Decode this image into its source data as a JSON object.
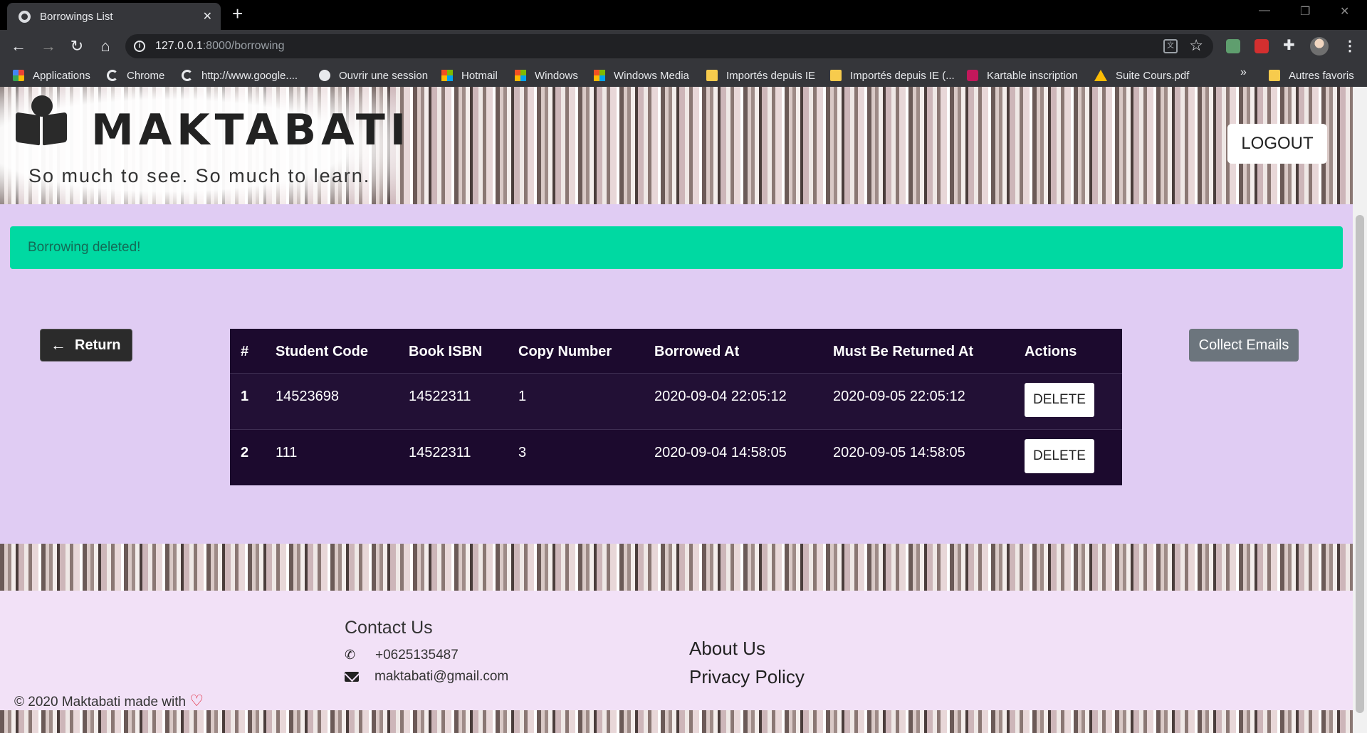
{
  "browser": {
    "tab_title": "Borrowings List",
    "url_host": "127.0.0.1",
    "url_rest": ":8000/borrowing",
    "bookmarks": [
      "Applications",
      "Chrome",
      "http://www.google....",
      "Ouvrir une session",
      "Hotmail",
      "Windows",
      "Windows Media",
      "Importés depuis IE",
      "Importés depuis IE (...",
      "Kartable inscription",
      "Suite Cours.pdf",
      "Autres favoris"
    ],
    "bookmark_icons": [
      "apps-icon",
      "google-icon",
      "google-icon",
      "globe-icon",
      "windows-icon",
      "windows-icon",
      "windows-icon",
      "folder-icon",
      "folder-icon",
      "kartable-icon",
      "drive-icon",
      "folder-icon"
    ]
  },
  "header": {
    "brand": "MAKTABATI",
    "tagline": "So much to see. So much to learn.",
    "logout_label": "LOGOUT"
  },
  "alert": {
    "message": "Borrowing deleted!",
    "color": "#00d9a2"
  },
  "actions": {
    "return_label": "Return",
    "collect_label": "Collect Emails"
  },
  "table": {
    "columns": [
      "#",
      "Student Code",
      "Book ISBN",
      "Copy Number",
      "Borrowed At",
      "Must Be Returned At",
      "Actions"
    ],
    "rows": [
      {
        "index": "1",
        "student_code": "14523698",
        "isbn": "14522311",
        "copy_number": "1",
        "borrowed_at": "2020-09-04 22:05:12",
        "due_at": "2020-09-05 22:05:12",
        "action": "DELETE"
      },
      {
        "index": "2",
        "student_code": "111",
        "isbn": "14522311",
        "copy_number": "3",
        "borrowed_at": "2020-09-04 14:58:05",
        "due_at": "2020-09-05 14:58:05",
        "action": "DELETE"
      }
    ]
  },
  "footer": {
    "contact_heading": "Contact Us",
    "phone": "+0625135487",
    "email": "maktabati@gmail.com",
    "about": "About Us",
    "privacy": "Privacy Policy",
    "copyright": "© 2020 Maktabati made with"
  },
  "colors": {
    "page_bg": "#e0ccf3",
    "table_bg": "#1c0a2e",
    "footer_bg": "#f2e1f7",
    "collect_btn": "#6c757d"
  }
}
